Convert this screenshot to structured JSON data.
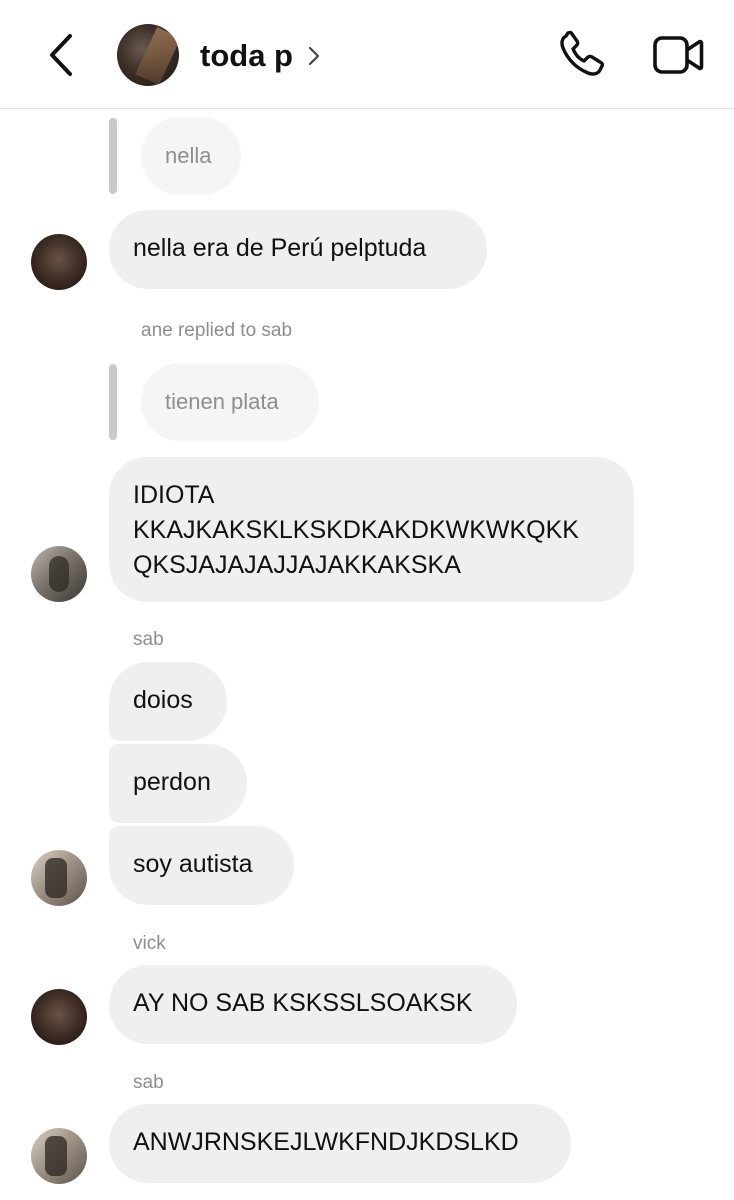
{
  "header": {
    "title": "toda p"
  },
  "messages": {
    "m1_quote": "nella",
    "m1_text": "nella era de Perú pelptuda",
    "m2_label": "ane replied to sab",
    "m2_quote": "tienen plata",
    "m2_line1": "IDIOTA",
    "m2_line2": "KKAJKAKSKLKSKDKAKDKWKWKQKK",
    "m2_line3": "QKSJAJAJAJJAJAKKAKSKA",
    "m3_sender": "sab",
    "m3_a": "doios",
    "m3_b": "perdon",
    "m3_c": "soy autista",
    "m4_sender": "vick",
    "m4_text": "AY NO SAB KSKSSLSOAKSK",
    "m5_sender": "sab",
    "m5_text": "ANWJRNSKEJLWKFNDJKDSLKD"
  },
  "icons": {
    "back": "chevron-left-icon",
    "call": "phone-icon",
    "video": "video-camera-icon",
    "title_chevron": "chevron-right-icon"
  }
}
